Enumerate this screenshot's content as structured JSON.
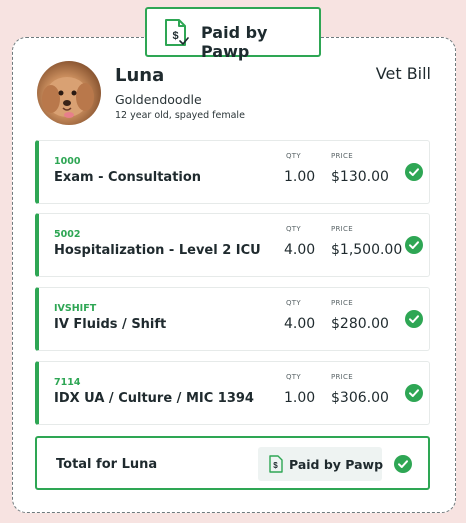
{
  "badge": {
    "label": "Paid by Pawp",
    "icon": "dollar-document-icon"
  },
  "pet": {
    "name": "Luna",
    "breed": "Goldendoodle",
    "info": "12 year old, spayed female"
  },
  "bill": {
    "title": "Vet Bill"
  },
  "columns": {
    "qty": "QTY",
    "price": "PRICE"
  },
  "items": [
    {
      "code": "1000",
      "description": "Exam - Consultation",
      "qty": "1.00",
      "price": "$130.00"
    },
    {
      "code": "5002",
      "description": "Hospitalization - Level 2 ICU",
      "qty": "4.00",
      "price": "$1,500.00"
    },
    {
      "code": "IVSHIFT",
      "description": "IV Fluids / Shift",
      "qty": "4.00",
      "price": "$280.00"
    },
    {
      "code": "7114",
      "description": "IDX UA / Culture / MIC 1394",
      "qty": "1.00",
      "price": "$306.00"
    }
  ],
  "total": {
    "label": "Total for Luna",
    "paid_label": "Paid by Pawp"
  },
  "colors": {
    "accent": "#2ea654",
    "background": "#f7e3e1",
    "text": "#1f2a2e"
  }
}
